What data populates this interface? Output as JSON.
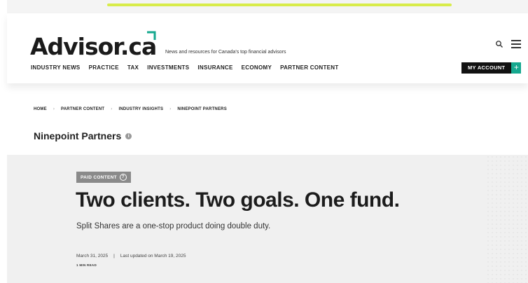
{
  "header": {
    "logo_text": "Advisor.ca",
    "tagline": "News and resources for Canada's top financial advisors",
    "nav": [
      "INDUSTRY NEWS",
      "PRACTICE",
      "TAX",
      "INVESTMENTS",
      "INSURANCE",
      "ECONOMY",
      "PARTNER CONTENT"
    ],
    "account_label": "MY ACCOUNT",
    "account_plus": "+",
    "icons": {
      "search": "search-icon",
      "menu": "hamburger-menu-icon",
      "logo_mark": "corner-bracket-icon"
    },
    "colors": {
      "accent_green": "#16a88f",
      "top_strip_accent": "#d8ec4a"
    }
  },
  "breadcrumb": {
    "items": [
      "HOME",
      "PARTNER CONTENT",
      "INDUSTRY INSIGHTS",
      "NINEPOINT PARTNERS"
    ],
    "separator": "›"
  },
  "partner": {
    "title": "Ninepoint Partners",
    "info_icon_text": "i"
  },
  "article": {
    "badge": "PAID CONTENT",
    "badge_icon_text": "?",
    "headline": "Two clients. Two goals. One fund.",
    "subhead": "Split Shares are a one-stop product doing double duty.",
    "date": "March 31, 2025",
    "meta_separator": "|",
    "updated": "Last updated on March 19, 2025",
    "read_time": "1 MIN READ"
  }
}
